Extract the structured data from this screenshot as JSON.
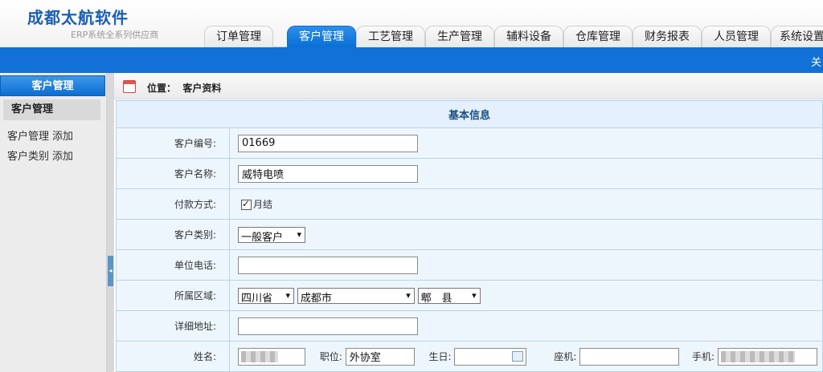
{
  "header": {
    "logo": "成都太航软件",
    "tagline": "ERP系统全系列供应商",
    "nav_tabs": [
      "订单管理",
      "客户管理",
      "工艺管理",
      "生产管理",
      "辅料设备",
      "仓库管理",
      "财务报表",
      "人员管理",
      "系统设置"
    ],
    "active_tab": "客户管理",
    "bluebar_text": "关"
  },
  "sidebar": {
    "heading": "客户管理",
    "subheading": "客户管理",
    "items": [
      {
        "label": "客户管理",
        "action": "添加"
      },
      {
        "label": "客户类别",
        "action": "添加"
      }
    ]
  },
  "location": {
    "prefix": "位置：",
    "page": "客户资料"
  },
  "form": {
    "section_title": "基本信息",
    "customer_no_label": "客户编号:",
    "customer_no": "01669",
    "customer_name_label": "客户名称:",
    "customer_name": "威特电喷",
    "payment_label": "付款方式:",
    "payment_option": "月结",
    "payment_checked": true,
    "category_label": "客户类别:",
    "category": "一般客户",
    "phone_label": "单位电话:",
    "phone": "",
    "region_label": "所属区域:",
    "province": "四川省",
    "city": "成都市",
    "county": "郫　县",
    "address_label": "详细地址:",
    "address": "",
    "contact_name_label": "姓名:",
    "contact_position_label": "职位:",
    "contact_position": "外协室",
    "birthday_label": "生日:",
    "landline_label": "座机:",
    "mobile_label": "手机:"
  },
  "colors": {
    "brand_blue": "#1171d6",
    "form_bg": "#eef6fd",
    "form_border": "#b7d3ea"
  }
}
